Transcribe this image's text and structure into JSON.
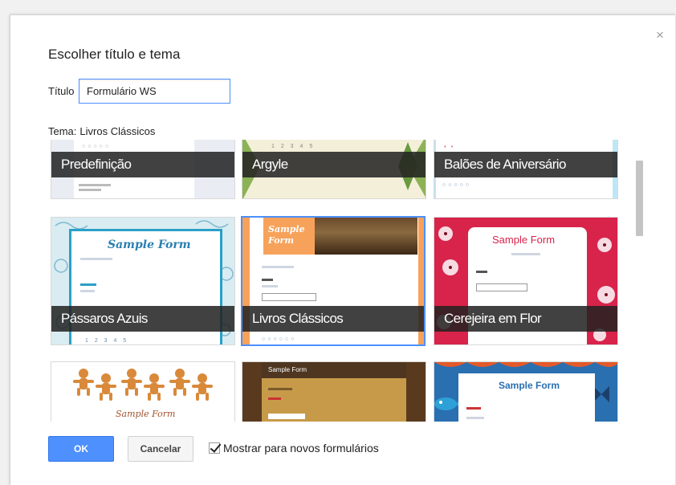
{
  "dialog": {
    "title": "Escolher título e tema",
    "close_glyph": "×",
    "title_field_label": "Título",
    "title_value": "Formulário WS",
    "theme_prefix": "Tema:",
    "theme_current": "Livros Clássicos"
  },
  "themes": [
    {
      "name": "Predefinição",
      "selected": false,
      "preview_heading": ""
    },
    {
      "name": "Argyle",
      "selected": false,
      "preview_heading": ""
    },
    {
      "name": "Balões de Aniversário",
      "selected": false,
      "preview_heading": ""
    },
    {
      "name": "Pássaros Azuis",
      "selected": false,
      "preview_heading": "Sample Form"
    },
    {
      "name": "Livros Clássicos",
      "selected": true,
      "preview_heading": "Sample Form"
    },
    {
      "name": "Cerejeira em Flor",
      "selected": false,
      "preview_heading": "Sample Form"
    },
    {
      "name": "",
      "selected": false,
      "preview_heading": "Sample Form"
    },
    {
      "name": "",
      "selected": false,
      "preview_heading": "Sample Form"
    },
    {
      "name": "",
      "selected": false,
      "preview_heading": "Sample Form"
    }
  ],
  "buttons": {
    "ok": "OK",
    "cancel": "Cancelar"
  },
  "checkbox": {
    "label": "Mostrar para novos formulários",
    "checked": true
  },
  "colors": {
    "accent": "#4d90fe",
    "caption_bg": "#222222",
    "teal": "#2aa0c8",
    "cherry": "#d8234a",
    "book_orange": "#f7a25a"
  },
  "icons": {
    "close": "close-icon",
    "checkmark": "checkmark-icon"
  }
}
